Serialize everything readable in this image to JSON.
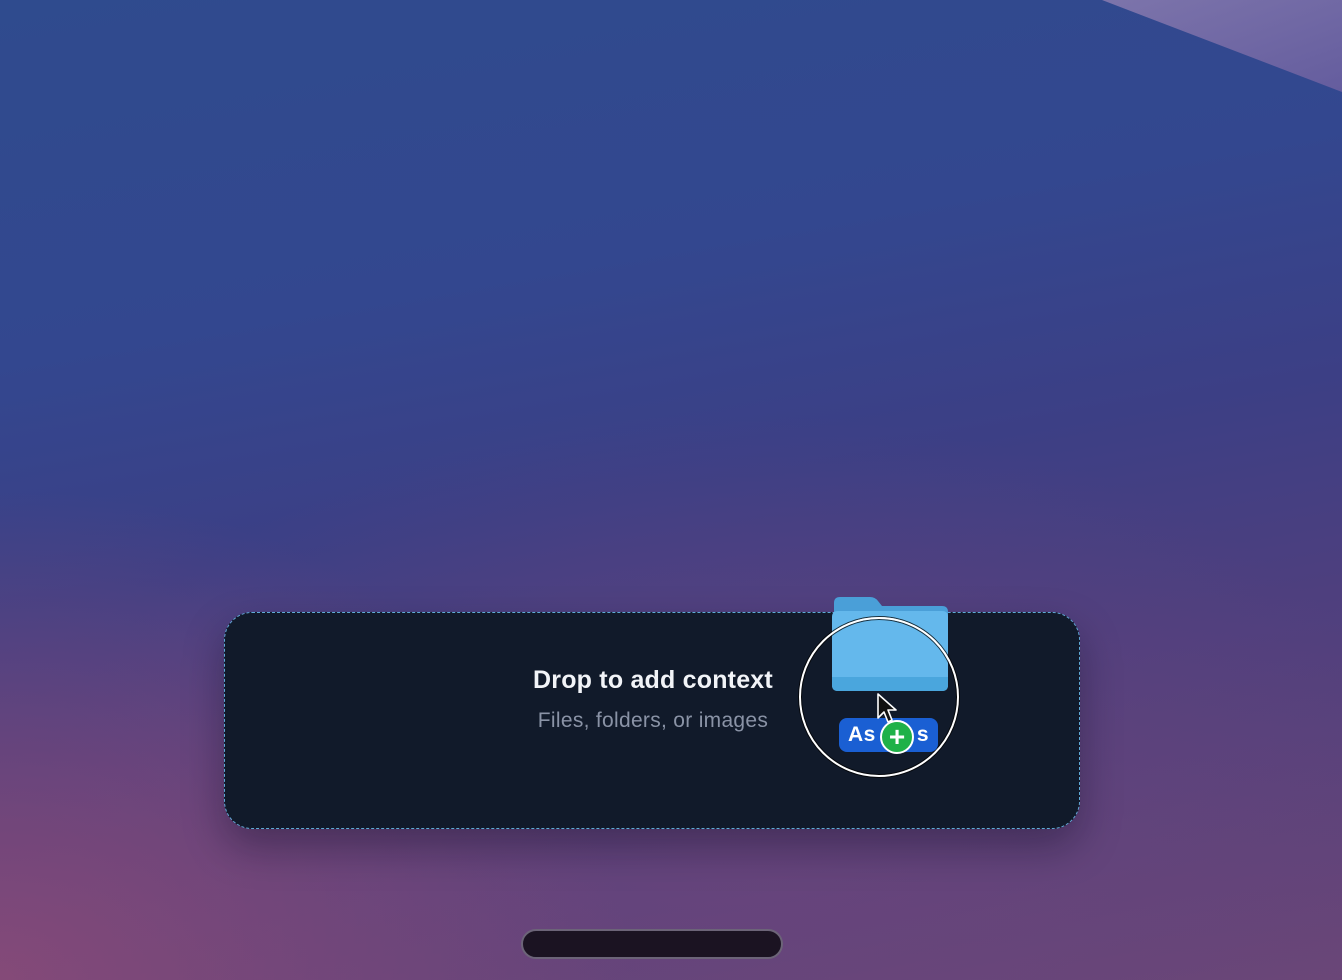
{
  "drop_zone": {
    "title": "Drop to add context",
    "subtitle": "Files, folders, or images"
  },
  "drag_item": {
    "icon": "folder-icon",
    "label_visible_start": "As",
    "label_visible_end": "s",
    "badge_icon": "plus-icon",
    "badge_symbol": "+"
  },
  "colors": {
    "drop_zone_border": "#5fa9d6",
    "drop_zone_background": "#111a2a",
    "label_background": "#1a5fd3",
    "badge_background": "#1fb148",
    "folder_blue": "#5db3e8"
  }
}
